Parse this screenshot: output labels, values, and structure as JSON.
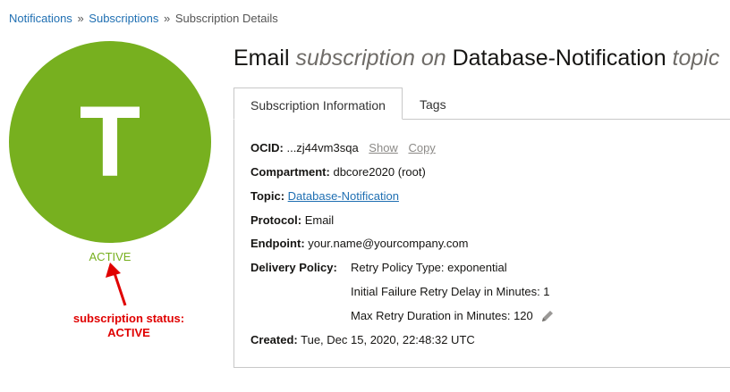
{
  "breadcrumb": {
    "items": [
      {
        "label": "Notifications"
      },
      {
        "label": "Subscriptions"
      }
    ],
    "separator": "»",
    "current": "Subscription Details"
  },
  "avatar": {
    "letter": "T",
    "color": "#77b01f"
  },
  "status": {
    "label": "ACTIVE",
    "color": "#77b01f"
  },
  "annotation": {
    "line1": "subscription status:",
    "line2": "ACTIVE",
    "color": "#e00000"
  },
  "title": {
    "protocol": "Email",
    "connector1": "subscription on",
    "topic_name": "Database-Notification",
    "connector2": "topic"
  },
  "tabs": [
    {
      "label": "Subscription Information",
      "active": true
    },
    {
      "label": "Tags",
      "active": false
    }
  ],
  "details": {
    "ocid": {
      "label": "OCID:",
      "value": "...zj44vm3sqa",
      "show": "Show",
      "copy": "Copy"
    },
    "compartment": {
      "label": "Compartment:",
      "value": "dbcore2020 (root)"
    },
    "topic": {
      "label": "Topic:",
      "value": "Database-Notification"
    },
    "protocol": {
      "label": "Protocol:",
      "value": "Email"
    },
    "endpoint": {
      "label": "Endpoint:",
      "value": "your.name@yourcompany.com"
    },
    "delivery_policy": {
      "label": "Delivery Policy:",
      "retry_policy_type": "Retry Policy Type: exponential",
      "initial_delay": "Initial Failure Retry Delay in Minutes: 1",
      "max_duration": "Max Retry Duration in Minutes: 120"
    },
    "created": {
      "label": "Created:",
      "value": "Tue, Dec 15, 2020, 22:48:32 UTC"
    }
  },
  "icons": {
    "edit": "pencil-icon",
    "arrow": "arrow-icon"
  }
}
